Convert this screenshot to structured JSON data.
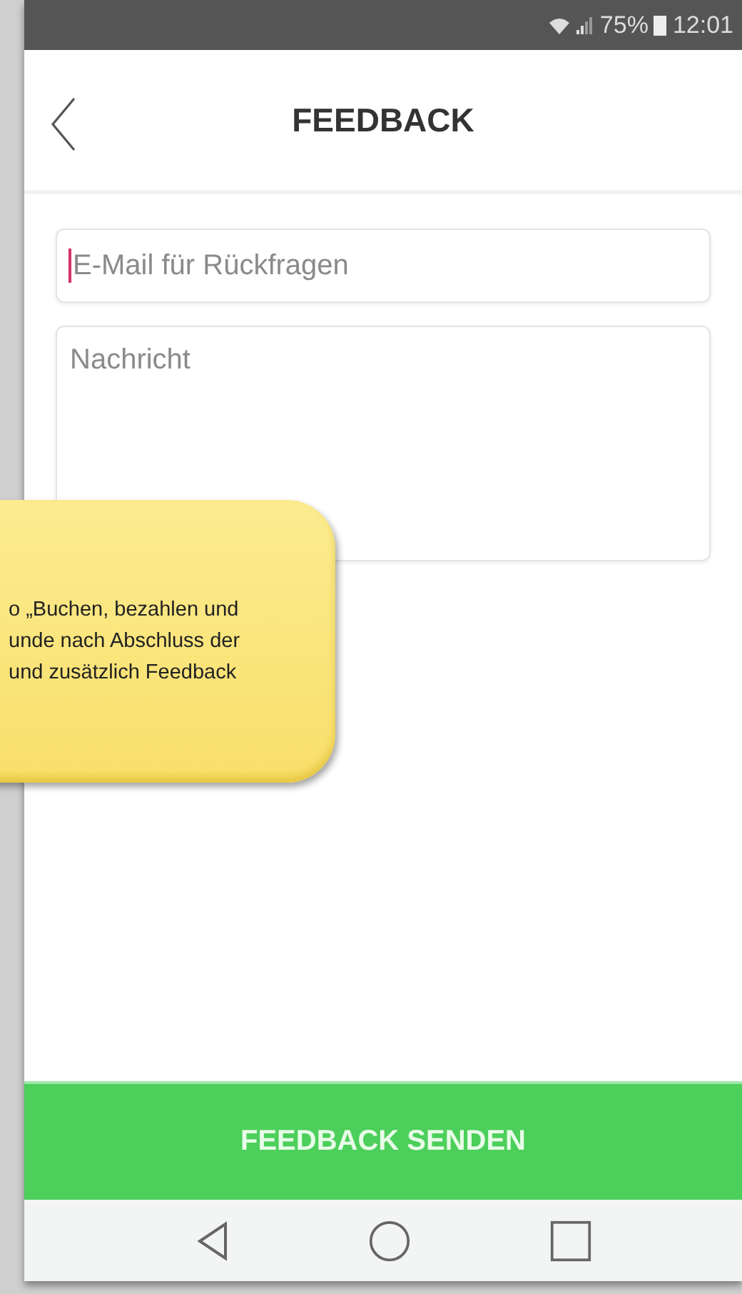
{
  "status_bar": {
    "battery": "75%",
    "time": "12:01"
  },
  "header": {
    "title": "FEEDBACK"
  },
  "form": {
    "email": {
      "placeholder": "E-Mail für Rückfragen"
    },
    "message": {
      "placeholder": "Nachricht"
    }
  },
  "callout": {
    "lines": [
      "o „Buchen, bezahlen und",
      "unde nach Abschluss der",
      "und zusätzlich Feedback"
    ]
  },
  "submit_button": {
    "label": "FEEDBACK SENDEN"
  }
}
